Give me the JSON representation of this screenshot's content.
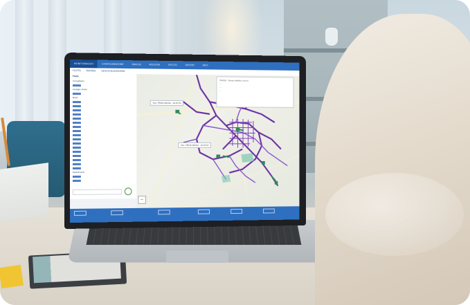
{
  "app": {
    "menu_tabs": [
      "MONITORAGGIO",
      "CONFIGURAZIONE",
      "ANALISI",
      "MISSIONI",
      "VEICOLI",
      "REPORT",
      "INFO"
    ],
    "active_tab": "MONITORAGGIO",
    "sub_tabs": [
      "FLOTTA",
      "RISORSE",
      "GEOLOCALIZZAZIONE"
    ]
  },
  "sidebar": {
    "tree_title": "Flotta",
    "group_1": "Compattatori",
    "group_2": "Lavaggio strade",
    "group_3": "Mezzi",
    "group_4": "Spazzamento"
  },
  "map": {
    "callout_1": "Veic. FP016 Attivita - 10:25:52",
    "callout_2": "Veic. FP016 Attivita - 10:25:52",
    "infobox_title": "FP0000 - Tempo effettivo lavoro"
  },
  "colors": {
    "app_blue": "#2f6fbf",
    "route_purple": "#6a2fa3",
    "route_violet": "#8a57c9",
    "route_green": "#2e8b57"
  }
}
